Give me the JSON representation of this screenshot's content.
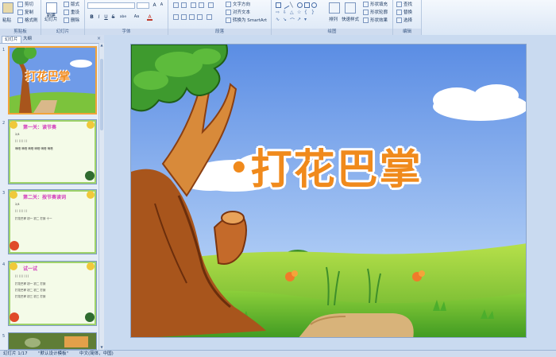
{
  "ribbon": {
    "clipboard": {
      "paste": "粘贴",
      "cut": "剪切",
      "copy": "复制",
      "format_painter": "格式刷",
      "label": "剪贴板"
    },
    "slides": {
      "new_slide": "新建\n幻灯片",
      "layout": "版式",
      "reset": "重设",
      "delete": "删除",
      "label": "幻灯片"
    },
    "font": {
      "font_name": "",
      "font_size": "",
      "label": "字体",
      "bold": "B",
      "italic": "I",
      "underline": "U",
      "strike": "S",
      "shadow": "abe",
      "grow": "A",
      "shrink": "A",
      "clear": "Aa",
      "color": "A"
    },
    "paragraph": {
      "label": "段落",
      "text_direction": "文字方向",
      "align_text": "对齐文本",
      "smartart": "转换为 SmartArt"
    },
    "drawing": {
      "label": "绘图",
      "arrange": "排列",
      "quick_styles": "快速样式",
      "shape_fill": "形状填充",
      "shape_outline": "形状轮廓",
      "shape_effects": "形状效果"
    },
    "editing": {
      "label": "编辑",
      "find": "查找",
      "replace": "替换",
      "select": "选择"
    }
  },
  "panel": {
    "tabs": [
      "幻灯片",
      "大纲"
    ],
    "close": "×",
    "thumbnails": [
      {
        "num": "1",
        "title": "打花巴掌"
      },
      {
        "num": "2",
        "title": "第一关：读节奏",
        "lines": [
          "2/4",
          "| | | | | | |",
          "嘀嗒 嘀嗒 嘀嗒 嘀嗒 嘀嗒 嘀嗒"
        ]
      },
      {
        "num": "3",
        "title": "第二关：按节奏读词",
        "lines": [
          "2/4",
          "| | | | | | |",
          "打花巴掌 初一 初二 打到 十一"
        ]
      },
      {
        "num": "4",
        "title": "试一试",
        "lines": [
          "| | | | | | | |",
          "打花巴掌 初一 初二 打到",
          "打花巴掌 初二 初二 打到",
          "打花巴掌 初三 初三 打到"
        ]
      },
      {
        "num": "5"
      }
    ]
  },
  "slide": {
    "title": "打花巴掌"
  },
  "status": {
    "slide_counter": "幻灯片 1/17",
    "theme": "\"默认设计模板\"",
    "language": "中文(简体，中国)"
  },
  "colors": {
    "title_orange": "#f08a1c",
    "sky_blue": "#6f9be8",
    "grass_green": "#7cc33c",
    "trunk_brown": "#a8551c",
    "selection": "#f2a33a"
  }
}
